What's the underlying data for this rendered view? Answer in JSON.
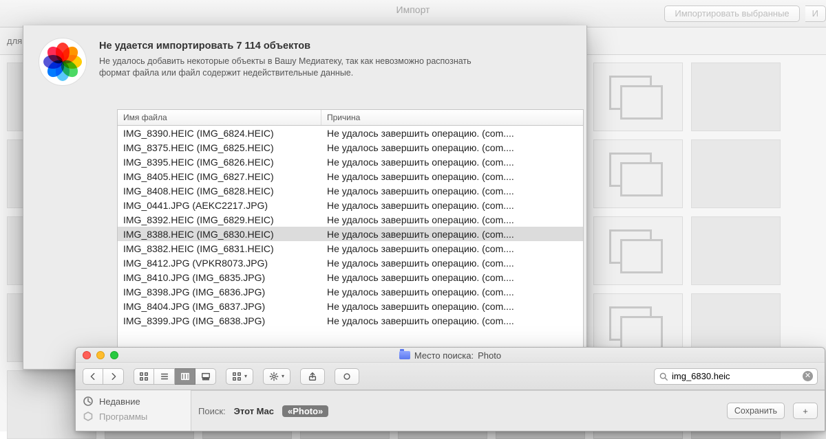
{
  "bg": {
    "title": "Импорт",
    "btn_import_selected": "Импортировать выбранные",
    "btn_fragment": "И",
    "subbar_fragment": "для з"
  },
  "dialog": {
    "title": "Не удается импортировать 7 114 объектов",
    "desc": "Не удалось добавить некоторые объекты в Вашу Медиатеку, так как невозможно распознать формат файла или файл содержит недействительные данные.",
    "columns": {
      "name": "Имя файла",
      "reason": "Причина"
    },
    "reason_text": "Не удалось завершить операцию. (com....",
    "selected_index": 7,
    "rows": [
      "IMG_8390.HEIC (IMG_6824.HEIC)",
      "IMG_8375.HEIC (IMG_6825.HEIC)",
      "IMG_8395.HEIC (IMG_6826.HEIC)",
      "IMG_8405.HEIC (IMG_6827.HEIC)",
      "IMG_8408.HEIC (IMG_6828.HEIC)",
      "IMG_0441.JPG (AEKC2217.JPG)",
      "IMG_8392.HEIC (IMG_6829.HEIC)",
      "IMG_8388.HEIC (IMG_6830.HEIC)",
      "IMG_8382.HEIC (IMG_6831.HEIC)",
      "IMG_8412.JPG (VPKR8073.JPG)",
      "IMG_8410.JPG (IMG_6835.JPG)",
      "IMG_8398.JPG (IMG_6836.JPG)",
      "IMG_8404.JPG (IMG_6837.JPG)",
      "IMG_8399.JPG (IMG_6838.JPG)"
    ]
  },
  "finder": {
    "title_prefix": "Место поиска:",
    "title_scope": "Photo",
    "sidebar": {
      "recents": "Недавние",
      "apps_fragment": "Программы"
    },
    "search_value": "img_6830.heic",
    "scope": {
      "label": "Поиск:",
      "this_mac": "Этот Mac",
      "pill": "«Photo»",
      "save": "Сохранить",
      "add": "+"
    }
  }
}
